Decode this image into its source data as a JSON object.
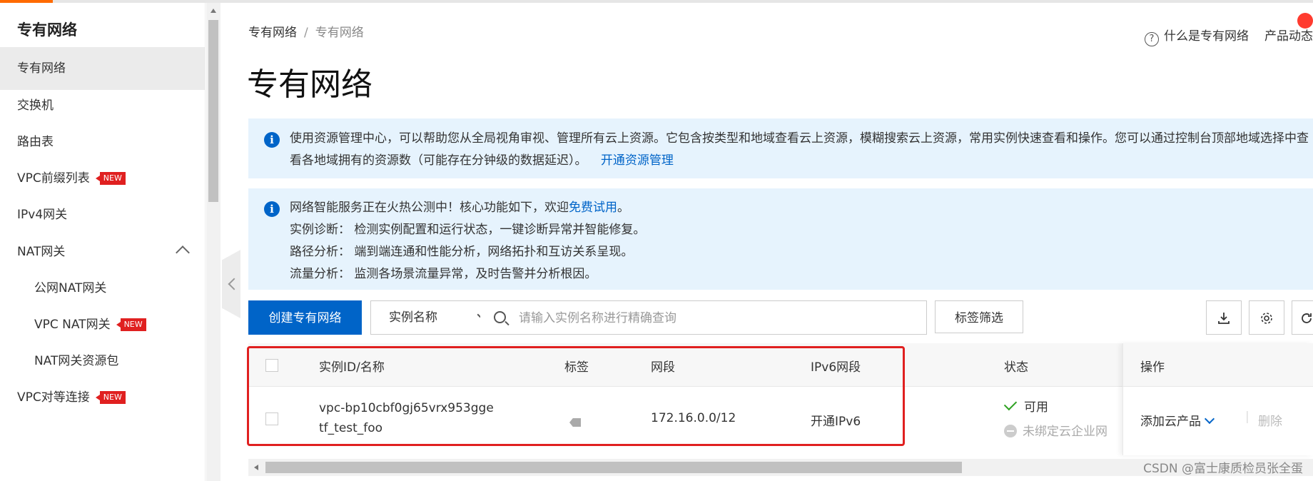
{
  "sidebar": {
    "title": "专有网络",
    "items": [
      {
        "label": "专有网络"
      },
      {
        "label": "交换机"
      },
      {
        "label": "路由表"
      },
      {
        "label": "VPC前缀列表",
        "badge": "NEW"
      },
      {
        "label": "IPv4网关"
      },
      {
        "label": "NAT网关"
      },
      {
        "label": "公网NAT网关"
      },
      {
        "label": "VPC NAT网关",
        "badge": "NEW"
      },
      {
        "label": "NAT网关资源包"
      },
      {
        "label": "VPC对等连接",
        "badge": "NEW"
      }
    ]
  },
  "breadcrumb": {
    "parent": "专有网络",
    "separator": "/",
    "current": "专有网络"
  },
  "header_links": {
    "help": "什么是专有网络",
    "news": "产品动态"
  },
  "page_title": "专有网络",
  "notice1": {
    "text": "使用资源管理中心，可以帮助您从全局视角审视、管理所有云上资源。它包含按类型和地域查看云上资源，模糊搜索云上资源，常用实例快速查看和操作。您可以通过控制台顶部地域选择中查看各地域拥有的资源数（可能存在分钟级的数据延迟）。",
    "link": "开通资源管理"
  },
  "notice2": {
    "intro": "网络智能服务正在火热公测中！核心功能如下，欢迎",
    "link": "免费试用",
    "intro_end": "。",
    "lines": [
      "实例诊断：  检测实例配置和运行状态，一键诊断异常并智能修复。",
      "路径分析：  端到端连通和性能分析，网络拓扑和互访关系呈现。",
      "流量分析：  监测各场景流量异常，及时告警并分析根因。"
    ]
  },
  "toolbar": {
    "create_label": "创建专有网络",
    "filter_select": "实例名称",
    "search_placeholder": "请输入实例名称进行精确查询",
    "tag_filter_label": "标签筛选"
  },
  "table": {
    "headers": {
      "id_name": "实例ID/名称",
      "tags": "标签",
      "cidr": "网段",
      "ipv6": "IPv6网段",
      "status": "状态",
      "actions": "操作"
    },
    "rows": [
      {
        "id": "vpc-bp10cbf0gj65vrx953gge",
        "name": "tf_test_foo",
        "cidr": "172.16.0.0/12",
        "ipv6": "开通IPv6",
        "status": "可用",
        "cen_status": "未绑定云企业网",
        "action_add": "添加云产品",
        "action_delete": "删除"
      }
    ]
  },
  "watermark": "CSDN @富士康质检员张全蛋"
}
